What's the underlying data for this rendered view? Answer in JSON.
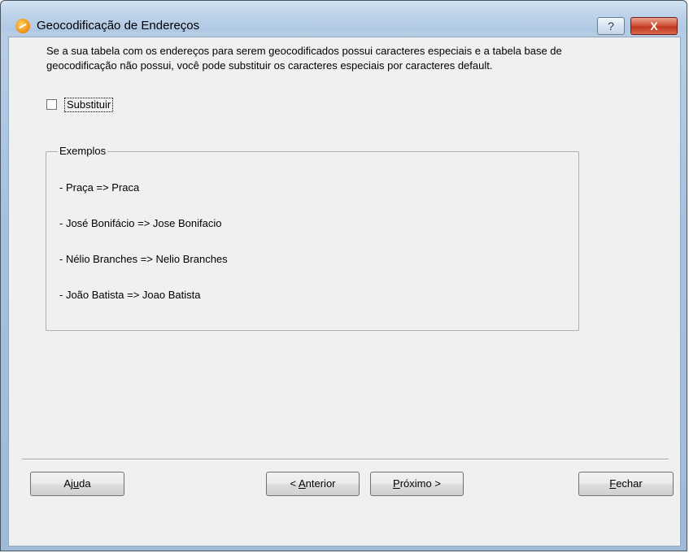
{
  "window": {
    "title": "Geocodificação de Endereços",
    "help_symbol": "?",
    "close_symbol": "X"
  },
  "intro": {
    "text": "Se a sua tabela com os endereços para serem geocodificados possui caracteres especiais e a tabela base de geocodificação não possui, você pode substituir os caracteres especiais por caracteres default."
  },
  "substituir": {
    "label": "Substituir",
    "checked": false
  },
  "examples": {
    "title": "Exemplos",
    "items": [
      "- Praça => Praca",
      "- José Bonifácio => Jose Bonifacio",
      "- Nélio Branches => Nelio Branches",
      "- João Batista => Joao Batista"
    ]
  },
  "buttons": {
    "help": {
      "pre": "Aj",
      "accel": "u",
      "post": "da"
    },
    "previous": {
      "pre": "< ",
      "accel": "A",
      "post": "nterior"
    },
    "next": {
      "pre": "",
      "accel": "P",
      "post": "róximo >"
    },
    "close": {
      "pre": "",
      "accel": "F",
      "post": "echar"
    }
  },
  "colors": {
    "titlebar": "#bed3ea",
    "client_background": "#f0f0f0",
    "close_button": "#c1391e"
  }
}
